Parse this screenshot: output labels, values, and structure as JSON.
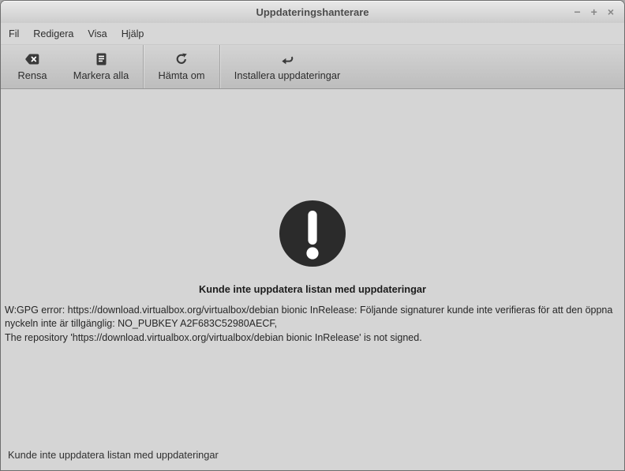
{
  "window": {
    "title": "Uppdateringshanterare",
    "controls": {
      "minimize": "−",
      "maximize": "+",
      "close": "×"
    }
  },
  "menubar": {
    "items": [
      {
        "label": "Fil"
      },
      {
        "label": "Redigera"
      },
      {
        "label": "Visa"
      },
      {
        "label": "Hjälp"
      }
    ]
  },
  "toolbar": {
    "buttons": [
      {
        "label": "Rensa",
        "icon": "backspace-clear-icon"
      },
      {
        "label": "Markera alla",
        "icon": "select-all-document-icon"
      },
      {
        "label": "Hämta om",
        "icon": "refresh-icon"
      },
      {
        "label": "Installera uppdateringar",
        "icon": "return-arrow-icon"
      }
    ]
  },
  "main": {
    "icon": "exclamation-circle-icon",
    "heading": "Kunde inte uppdatera listan med uppdateringar",
    "error_lines": [
      "W:GPG error: https://download.virtualbox.org/virtualbox/debian bionic InRelease: Följande signaturer kunde inte verifieras för att den öppna",
      "nyckeln inte är tillgänglig: NO_PUBKEY A2F683C52980AECF,",
      "The repository 'https://download.virtualbox.org/virtualbox/debian bionic InRelease' is not signed."
    ]
  },
  "statusbar": {
    "text": "Kunde inte uppdatera listan med uppdateringar"
  },
  "colors": {
    "titlebar_top": "#e9e9e9",
    "titlebar_bottom": "#cccccc",
    "window_bg": "#d5d5d5",
    "toolbar_bottom": "#bdbdbd",
    "toolbar_border": "#979797",
    "icon_dark": "#3a3a3a",
    "error_icon_bg": "#2b2b2b",
    "text_dark": "#262626"
  }
}
